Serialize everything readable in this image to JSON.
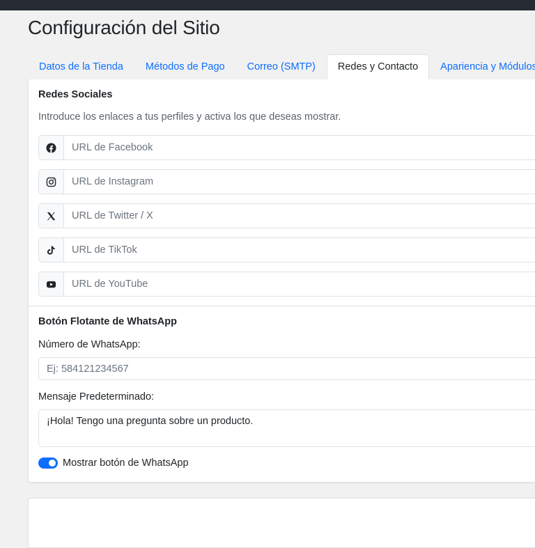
{
  "page": {
    "title": "Configuración del Sitio"
  },
  "tabs": [
    {
      "label": "Datos de la Tienda",
      "active": false
    },
    {
      "label": "Métodos de Pago",
      "active": false
    },
    {
      "label": "Correo (SMTP)",
      "active": false
    },
    {
      "label": "Redes y Contacto",
      "active": true
    },
    {
      "label": "Apariencia y Módulos",
      "active": false
    }
  ],
  "social": {
    "title": "Redes Sociales",
    "help": "Introduce los enlaces a tus perfiles y activa los que deseas mostrar.",
    "fields": [
      {
        "icon": "facebook-icon",
        "placeholder": "URL de Facebook",
        "value": ""
      },
      {
        "icon": "instagram-icon",
        "placeholder": "URL de Instagram",
        "value": ""
      },
      {
        "icon": "twitter-x-icon",
        "placeholder": "URL de Twitter / X",
        "value": ""
      },
      {
        "icon": "tiktok-icon",
        "placeholder": "URL de TikTok",
        "value": ""
      },
      {
        "icon": "youtube-icon",
        "placeholder": "URL de YouTube",
        "value": ""
      }
    ]
  },
  "whatsapp": {
    "title": "Botón Flotante de WhatsApp",
    "number_label": "Número de WhatsApp:",
    "number_placeholder": "Ej: 584121234567",
    "number_value": "",
    "message_label": "Mensaje Predeterminado:",
    "message_value": "¡Hola! Tengo una pregunta sobre un producto.",
    "toggle_label": "Mostrar botón de WhatsApp",
    "toggle_on": true
  },
  "colors": {
    "accent": "#0d6efd",
    "topbar": "#262b33",
    "background": "#f1f1f1"
  }
}
